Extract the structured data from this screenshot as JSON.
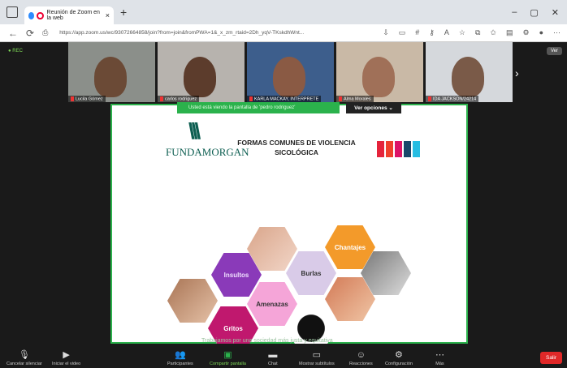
{
  "browser": {
    "tab_title": "Reunión de Zoom en la web",
    "tab_close": "×",
    "new_tab": "+",
    "url": "https://app.zoom.us/wc/93072664858/join?from=join&fromPWA=1&_x_zm_rtaid=2Dh_yqV-TKskdhWnt...",
    "minimize": "–",
    "restore": "▢",
    "close": "✕"
  },
  "gallery": {
    "participants": [
      {
        "name": "Lucila Gómez",
        "bg": "#8b8f8a",
        "skin": "#6b4a36"
      },
      {
        "name": "carlos rodriguez",
        "bg": "#b7b3ae",
        "skin": "#5c3c2c"
      },
      {
        "name": "KARLA MACKAY, INTERPRETE",
        "bg": "#3d5e8c",
        "skin": "#8a5a44"
      },
      {
        "name": "Alma Morales",
        "bg": "#c9b9a6",
        "skin": "#a07058"
      },
      {
        "name": "IDA JACKSON/24214",
        "bg": "#d5d8dc",
        "skin": "#7a5a48"
      }
    ],
    "next": "›",
    "top_left": "● REC",
    "view_label": "Ver"
  },
  "share": {
    "status": "Usted está viendo la pantalla de 'pedro rodriguez' ",
    "view_options": "Ver opciones ⌄"
  },
  "slide": {
    "logo_mark": "\\\\\\",
    "logo_text": "FUNDAMORGAN",
    "title_line1": "FORMAS COMUNES DE VIOLENCIA",
    "title_line2": "SICOLÓGICA",
    "labels": {
      "insultos": "Insultos",
      "burlas": "Burlas",
      "chantajes": "Chantajes",
      "amenazas": "Amenazas",
      "gritos": "Gritos"
    },
    "footer": "Trabajamos por una sociedad más justa y equitativa"
  },
  "toolbar": {
    "mute": "Cancelar silenciar",
    "video": "Iniciar el video",
    "participants": "Participantes",
    "participants_count": "25",
    "share": "Compartir pantalla",
    "chat": "Chat",
    "subtitles": "Mostrar subtítulos",
    "reactions": "Reacciones",
    "settings": "Configuración",
    "more": "Más",
    "leave": "Salir"
  },
  "colors": {
    "zoom_green": "#2bb24c",
    "leave_red": "#e02828",
    "insultos": "#8a3ab9",
    "burlas": "#d9cbe8",
    "chantajes": "#f39a2a",
    "amenazas": "#f5a5d8",
    "gritos": "#c0186e"
  }
}
